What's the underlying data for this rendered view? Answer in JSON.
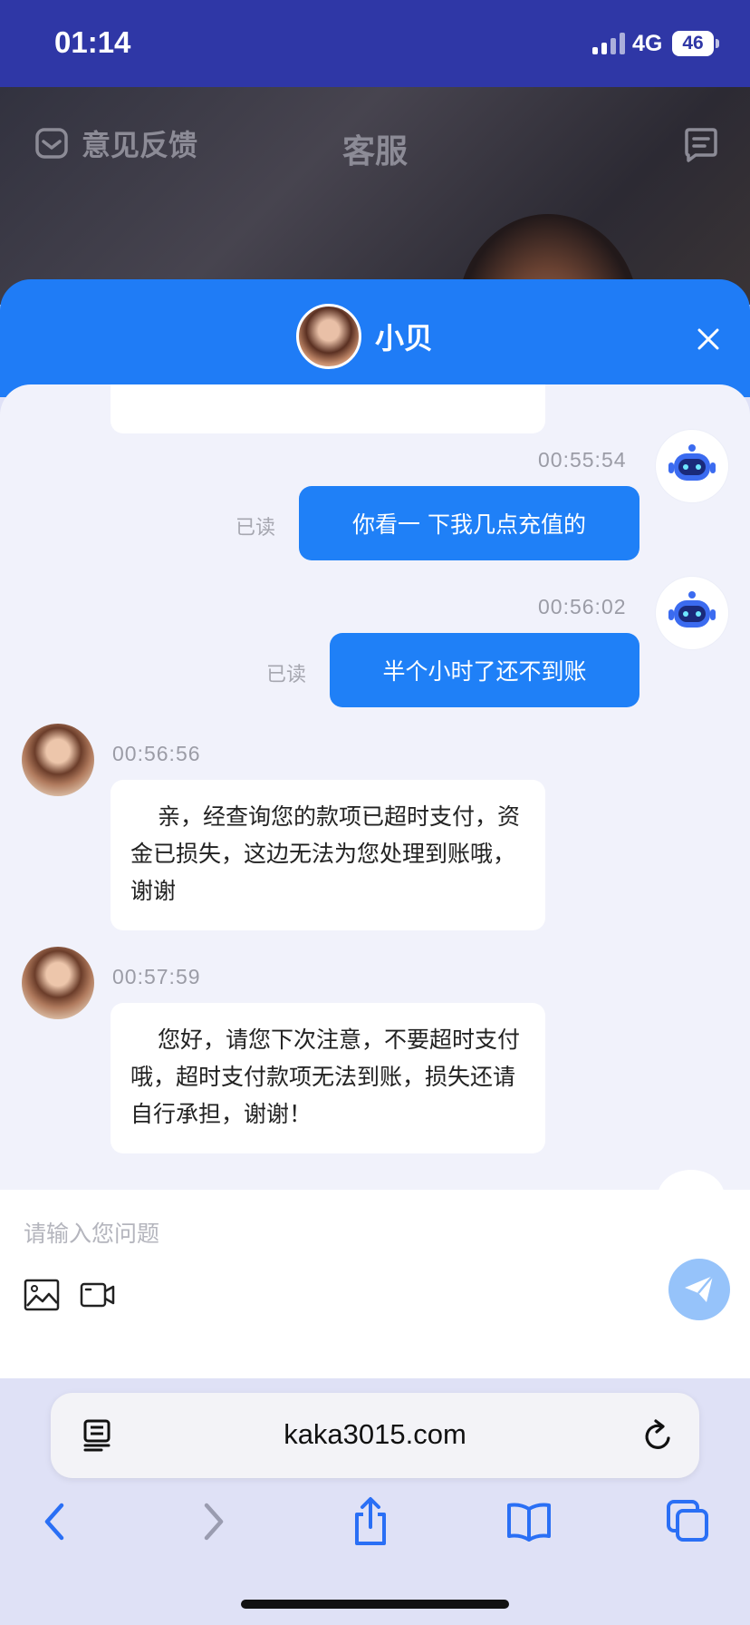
{
  "status_bar": {
    "time": "01:14",
    "network": "4G",
    "battery": "46"
  },
  "page": {
    "feedback_label": "意见反馈",
    "title": "客服"
  },
  "chat": {
    "agent_name": "小贝",
    "messages": [
      {
        "type": "outgoing",
        "time": "00:55:54",
        "text": "你看一 下我几点充值的",
        "read_label": "已读"
      },
      {
        "type": "outgoing",
        "time": "00:56:02",
        "text": "半个小时了还不到账",
        "read_label": "已读"
      },
      {
        "type": "incoming",
        "time": "00:56:56",
        "text": "亲，经查询您的款项已超时支付，资金已损失，这边无法为您处理到账哦，谢谢"
      },
      {
        "type": "incoming",
        "time": "00:57:59",
        "text": "您好，请您下次注意，不要超时支付哦，超时支付款项无法到账，损失还请自行承担，谢谢！"
      }
    ]
  },
  "composer": {
    "placeholder": "请输入您问题",
    "value": ""
  },
  "browser": {
    "url": "kaka3015.com"
  },
  "colors": {
    "primary": "#1f7cf6",
    "status_bar": "#2f37a6",
    "send_disabled": "#96c3fa"
  }
}
